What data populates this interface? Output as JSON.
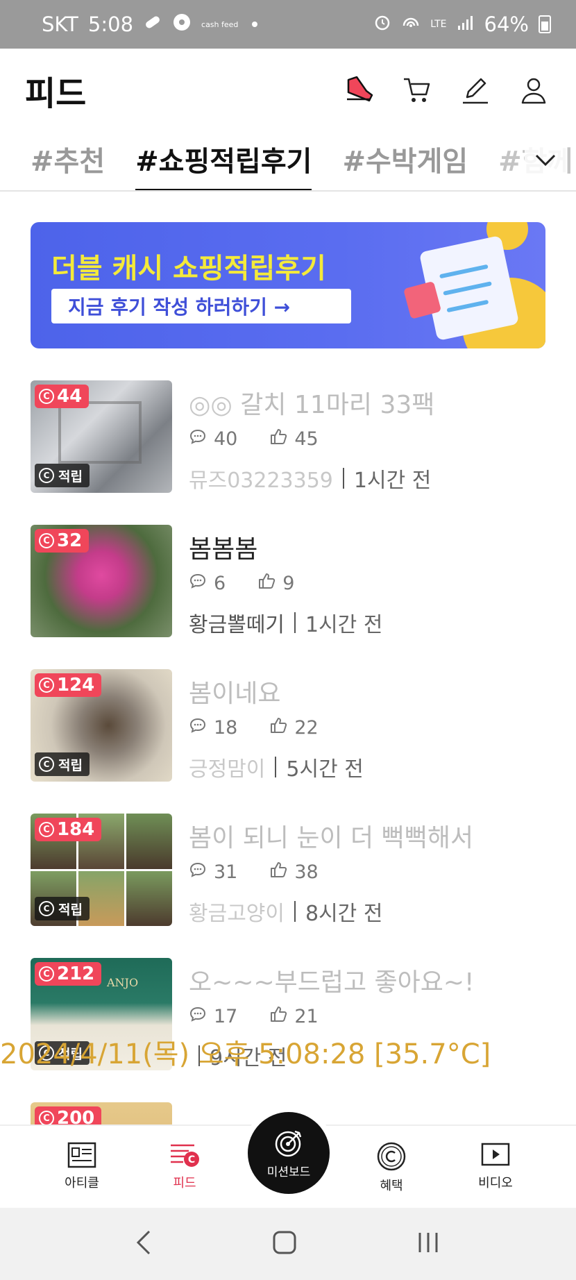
{
  "status_bar": {
    "carrier": "SKT",
    "time": "5:08",
    "cashfeed_label": "cash feed",
    "network": "LTE",
    "battery": "64%",
    "battery_level": 0.64
  },
  "header": {
    "title": "피드",
    "icons": [
      "mission-shoe-icon",
      "cart-icon",
      "pencil-icon",
      "profile-icon"
    ]
  },
  "tabs": [
    {
      "label": "#추천",
      "active": false
    },
    {
      "label": "#쇼핑적립후기",
      "active": true
    },
    {
      "label": "#수박게임",
      "active": false
    },
    {
      "label": "#함께",
      "active": false
    }
  ],
  "banner": {
    "title": "더블 캐시 쇼핑적립후기",
    "button": "지금 후기 작성 하러하기 →"
  },
  "feed": [
    {
      "badge": "44",
      "accrue": "적립",
      "title": "갈치 11마리 33팩",
      "comments": "40",
      "likes": "45",
      "author": "뮤즈03223359",
      "time": "1시간 전",
      "dark": false
    },
    {
      "badge": "32",
      "accrue": "",
      "title": "봄봄봄",
      "comments": "6",
      "likes": "9",
      "author": "황금뽈떼기",
      "time": "1시간 전",
      "dark": true
    },
    {
      "badge": "124",
      "accrue": "적립",
      "title": "봄이네요",
      "comments": "18",
      "likes": "22",
      "author": "긍정맘이",
      "time": "5시간 전",
      "dark": false
    },
    {
      "badge": "184",
      "accrue": "적립",
      "title": "봄이 되니 눈이 더 뻑뻑해서",
      "comments": "31",
      "likes": "38",
      "author": "황금고양이",
      "time": "8시간 전",
      "dark": false
    },
    {
      "badge": "212",
      "accrue": "적립",
      "title": "오~~~부드럽고 좋아요~!",
      "comments": "17",
      "likes": "21",
      "author": "",
      "time": "9시간 전",
      "dark": false
    },
    {
      "badge": "200",
      "accrue": "",
      "title": "",
      "comments": "",
      "likes": "",
      "author": "",
      "time": "",
      "dark": false
    }
  ],
  "overlay_timestamp": "2024/4/11(목) 오후 5:08:28 [35.7°C]",
  "bottom_nav": {
    "items": [
      {
        "label": "아티클",
        "icon": "article-icon"
      },
      {
        "label": "피드",
        "icon": "feed-icon"
      },
      {
        "label": "혜택",
        "icon": "benefit-icon"
      },
      {
        "label": "비디오",
        "icon": "video-icon"
      }
    ],
    "center_label": "미션보드"
  },
  "colors": {
    "accent": "#e0304d",
    "badge": "#f0465a",
    "banner": "#5063ec",
    "banner_title": "#f4ea3a"
  }
}
